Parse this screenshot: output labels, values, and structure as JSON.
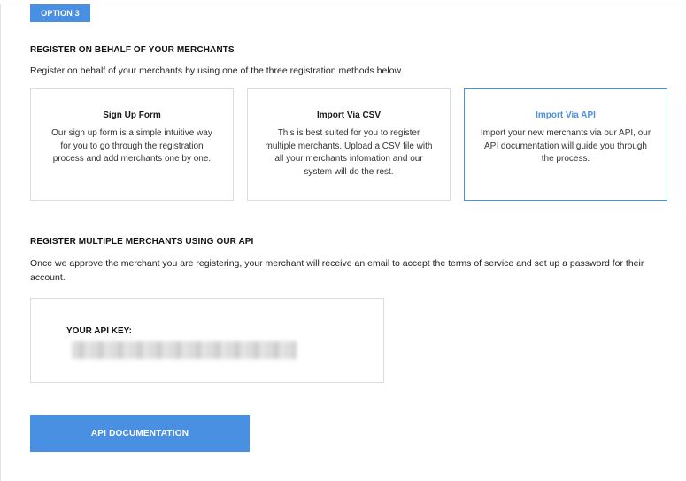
{
  "option_tab": "OPTION 3",
  "section1": {
    "heading": "REGISTER ON BEHALF OF YOUR MERCHANTS",
    "description": "Register on behalf of your merchants by using one of the three registration methods below."
  },
  "methods": [
    {
      "title": "Sign Up Form",
      "description": "Our sign up form is a simple intuitive way for you to go through the registration process and add merchants one by one.",
      "selected": false
    },
    {
      "title": "Import Via CSV",
      "description": "This is best suited for you to register multiple merchants. Upload a CSV file with all your merchants infomation and our system will do the rest.",
      "selected": false
    },
    {
      "title": "Import Via API",
      "description": "Import your new merchants via our API, our API documentation will guide you through the process.",
      "selected": true
    }
  ],
  "section2": {
    "heading": "REGISTER MULTIPLE MERCHANTS USING OUR API",
    "description": "Once we approve the merchant you are registering, your merchant will receive an email to accept the terms of service and set up a password for their account."
  },
  "api_key": {
    "label": "YOUR API KEY:"
  },
  "api_button": "API DOCUMENTATION",
  "colors": {
    "accent": "#4a90e2",
    "border": "#dcdcdc"
  }
}
